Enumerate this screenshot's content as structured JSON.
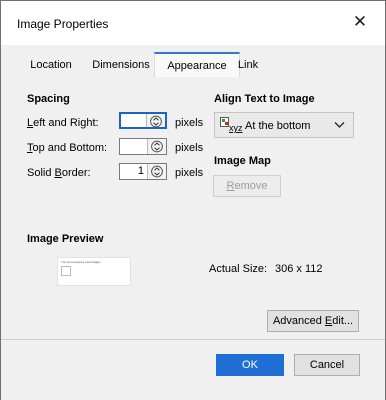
{
  "window": {
    "title": "Image Properties"
  },
  "tabs": [
    {
      "label": "Location",
      "active": false
    },
    {
      "label": "Dimensions",
      "active": false
    },
    {
      "label": "Appearance",
      "active": true
    },
    {
      "label": "Link",
      "active": false
    }
  ],
  "spacing": {
    "heading": "Spacing",
    "left_right": {
      "label_pre": "",
      "label_u": "L",
      "label_post": "eft and Right:",
      "value": "",
      "unit": "pixels"
    },
    "top_bottom": {
      "label_pre": "",
      "label_u": "T",
      "label_post": "op and Bottom:",
      "value": "",
      "unit": "pixels"
    },
    "border": {
      "label_pre": "Solid ",
      "label_u": "B",
      "label_post": "order:",
      "value": "1",
      "unit": "pixels"
    }
  },
  "align": {
    "heading": "Align Text to Image",
    "selected": "At the bottom",
    "icon_text": "xyz"
  },
  "image_map": {
    "heading": "Image Map",
    "remove_u": "R",
    "remove_rest": "emove"
  },
  "preview": {
    "heading": "Image Preview",
    "actual_size_label": "Actual Size:",
    "actual_size_value": "306 x 112",
    "thumb_text": "You just earned a new badge!"
  },
  "advanced": {
    "pre": "Advanced ",
    "u": "E",
    "post": "dit..."
  },
  "buttons": {
    "ok": "OK",
    "cancel": "Cancel"
  },
  "colors": {
    "accent": "#1f6fd6"
  }
}
